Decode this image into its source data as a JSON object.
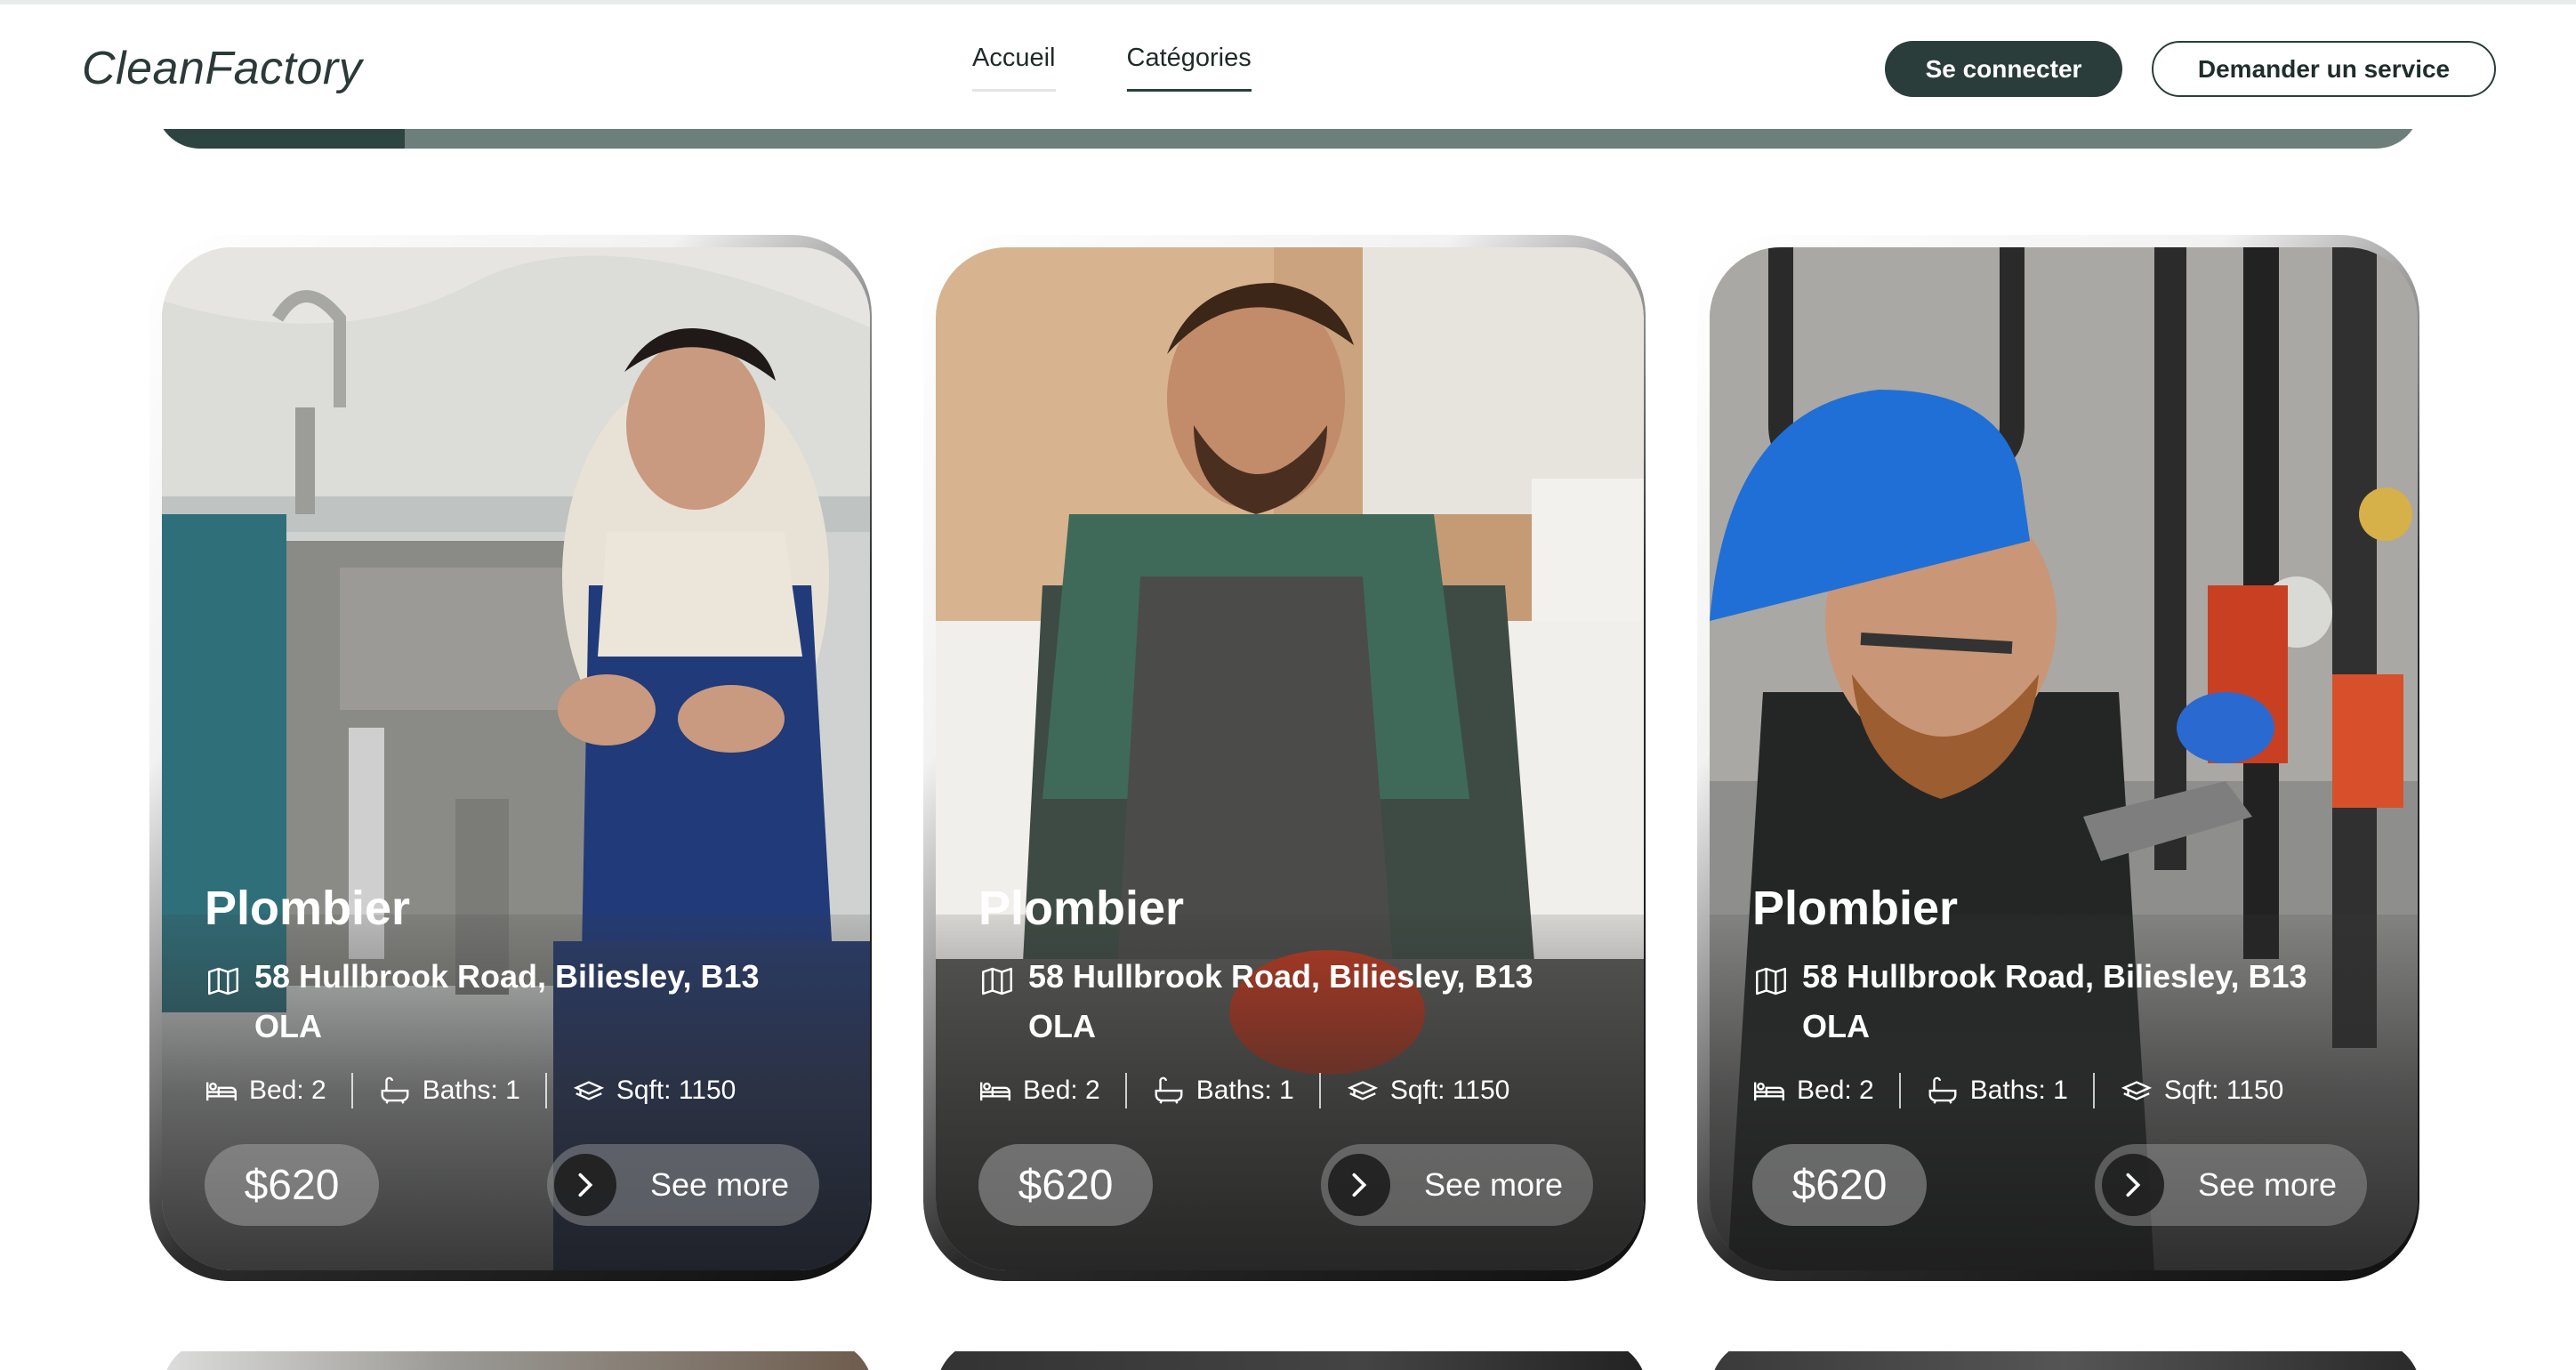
{
  "header": {
    "brand": "CleanFactory",
    "nav": [
      {
        "label": "Accueil",
        "active": false
      },
      {
        "label": "Catégories",
        "active": true
      }
    ],
    "login_label": "Se connecter",
    "request_label": "Demander un service"
  },
  "progress": {
    "fill_fraction": 0.11
  },
  "cards": [
    {
      "title": "Plombier",
      "address": "58 Hullbrook Road, Biliesley, B13 OLA",
      "bed": "Bed: 2",
      "baths": "Baths: 1",
      "sqft": "Sqft: 1150",
      "price": "$620",
      "cta": "See more"
    },
    {
      "title": "Plombier",
      "address": "58 Hullbrook Road, Biliesley, B13 OLA",
      "bed": "Bed: 2",
      "baths": "Baths: 1",
      "sqft": "Sqft: 1150",
      "price": "$620",
      "cta": "See more"
    },
    {
      "title": "Plombier",
      "address": "58 Hullbrook Road, Biliesley, B13 OLA",
      "bed": "Bed: 2",
      "baths": "Baths: 1",
      "sqft": "Sqft: 1150",
      "price": "$620",
      "cta": "See more"
    }
  ],
  "colors": {
    "primary": "#2b3d3b",
    "progress_track": "#6d7f7a",
    "progress_fill": "#2e4440"
  },
  "icons": [
    "map-icon",
    "bed-icon",
    "bath-icon",
    "sqft-icon",
    "chevron-right-icon"
  ]
}
